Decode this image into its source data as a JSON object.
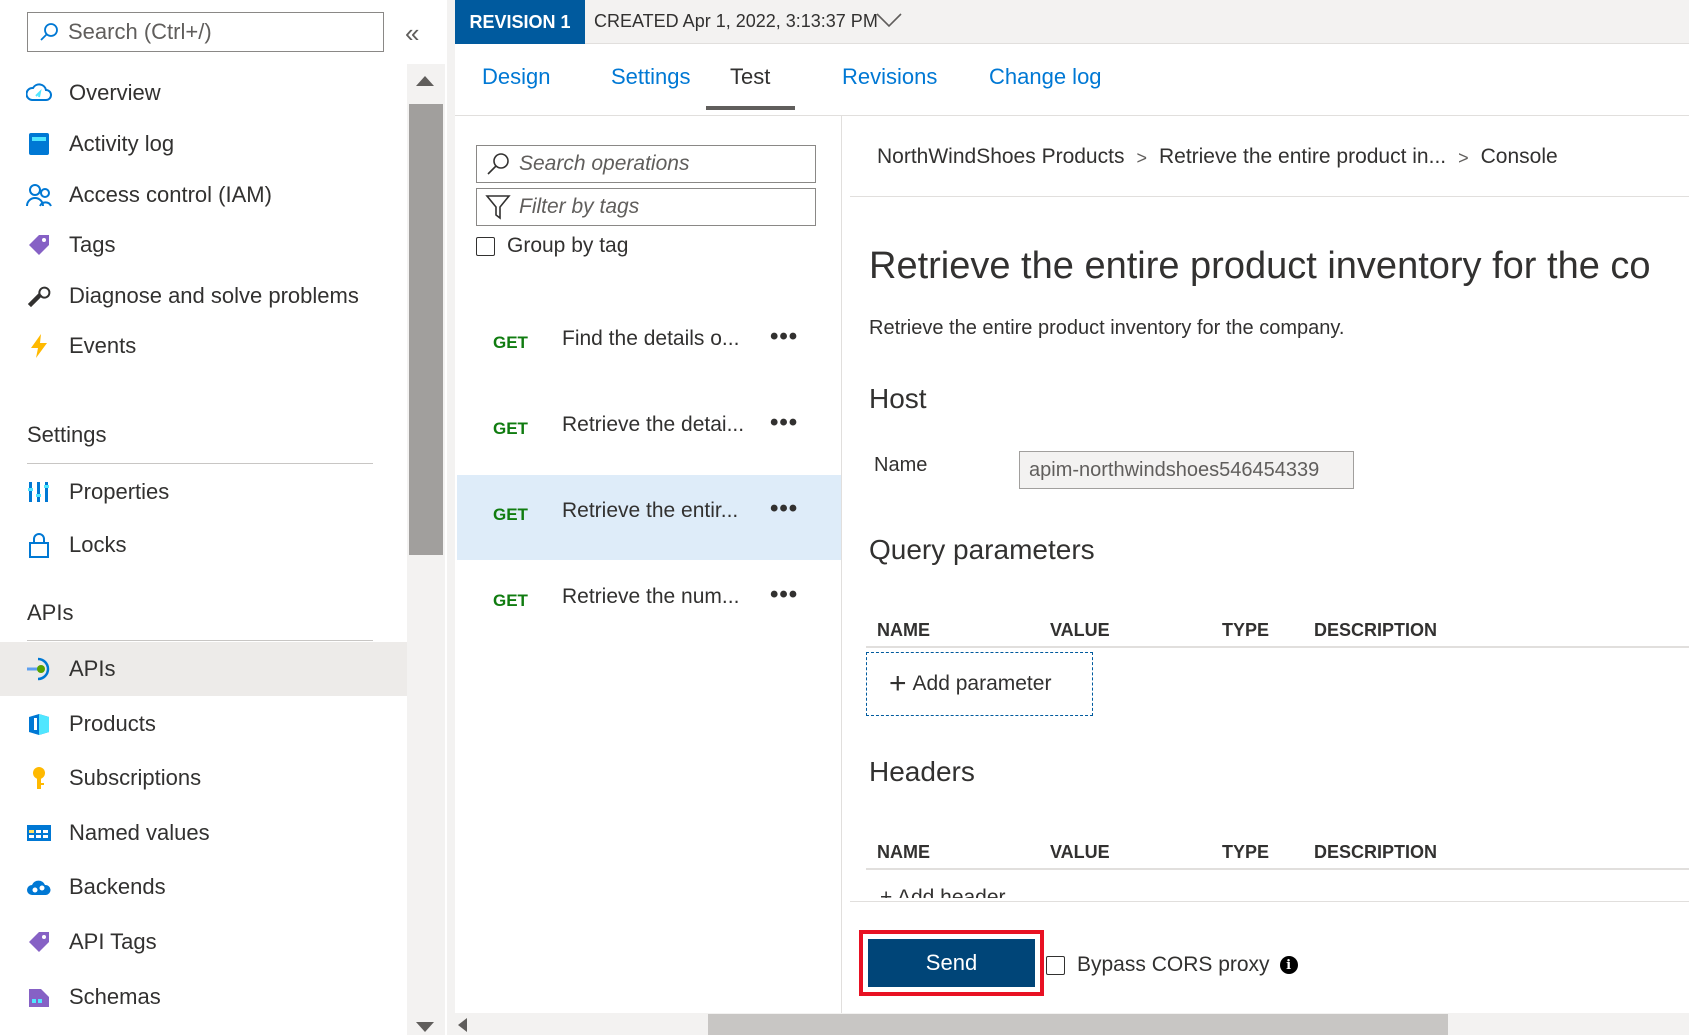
{
  "sidebar": {
    "search_placeholder": "Search (Ctrl+/)",
    "collapse_icon": "double-chevron-left-icon",
    "top_items": [
      {
        "label": "Overview",
        "icon": "cloud-icon"
      },
      {
        "label": "Activity log",
        "icon": "activity-log-icon"
      },
      {
        "label": "Access control (IAM)",
        "icon": "people-icon"
      },
      {
        "label": "Tags",
        "icon": "tag-icon"
      },
      {
        "label": "Diagnose and solve problems",
        "icon": "wrench-icon"
      },
      {
        "label": "Events",
        "icon": "lightning-icon"
      }
    ],
    "settings_header": "Settings",
    "settings_items": [
      {
        "label": "Properties",
        "icon": "properties-icon"
      },
      {
        "label": "Locks",
        "icon": "lock-icon"
      }
    ],
    "apis_header": "APIs",
    "apis_items": [
      {
        "label": "APIs",
        "icon": "api-icon",
        "active": true
      },
      {
        "label": "Products",
        "icon": "products-icon"
      },
      {
        "label": "Subscriptions",
        "icon": "key-icon"
      },
      {
        "label": "Named values",
        "icon": "named-values-icon"
      },
      {
        "label": "Backends",
        "icon": "backends-icon"
      },
      {
        "label": "API Tags",
        "icon": "tag-icon"
      },
      {
        "label": "Schemas",
        "icon": "schemas-icon"
      }
    ]
  },
  "header": {
    "revision_badge": "REVISION 1",
    "created_text": "CREATED Apr 1, 2022, 3:13:37 PM"
  },
  "tabs": [
    {
      "label": "Design"
    },
    {
      "label": "Settings"
    },
    {
      "label": "Test",
      "active": true
    },
    {
      "label": "Revisions"
    },
    {
      "label": "Change log"
    }
  ],
  "operations": {
    "search_placeholder": "Search operations",
    "filter_placeholder": "Filter by tags",
    "group_by_label": "Group by tag",
    "more_label": "•••",
    "items": [
      {
        "method": "GET",
        "name": "Find the details o..."
      },
      {
        "method": "GET",
        "name": "Retrieve the detai..."
      },
      {
        "method": "GET",
        "name": "Retrieve the entir...",
        "selected": true
      },
      {
        "method": "GET",
        "name": "Retrieve the num..."
      }
    ]
  },
  "console": {
    "breadcrumb": [
      "NorthWindShoes Products",
      "Retrieve the entire product in...",
      "Console"
    ],
    "breadcrumb_sep": ">",
    "title": "Retrieve the entire product inventory for the co",
    "description": "Retrieve the entire product inventory for the company.",
    "host": {
      "header": "Host",
      "name_label": "Name",
      "name_value": "apim-northwindshoes546454339"
    },
    "query": {
      "header": "Query parameters",
      "columns": [
        "NAME",
        "VALUE",
        "TYPE",
        "DESCRIPTION"
      ],
      "add_label": "Add parameter"
    },
    "headers": {
      "header": "Headers",
      "columns": [
        "NAME",
        "VALUE",
        "TYPE",
        "DESCRIPTION"
      ],
      "add_label": "+ Add header"
    },
    "send_label": "Send",
    "bypass_label": "Bypass CORS proxy",
    "info_glyph": "i",
    "highlight_color": "#e81123"
  }
}
